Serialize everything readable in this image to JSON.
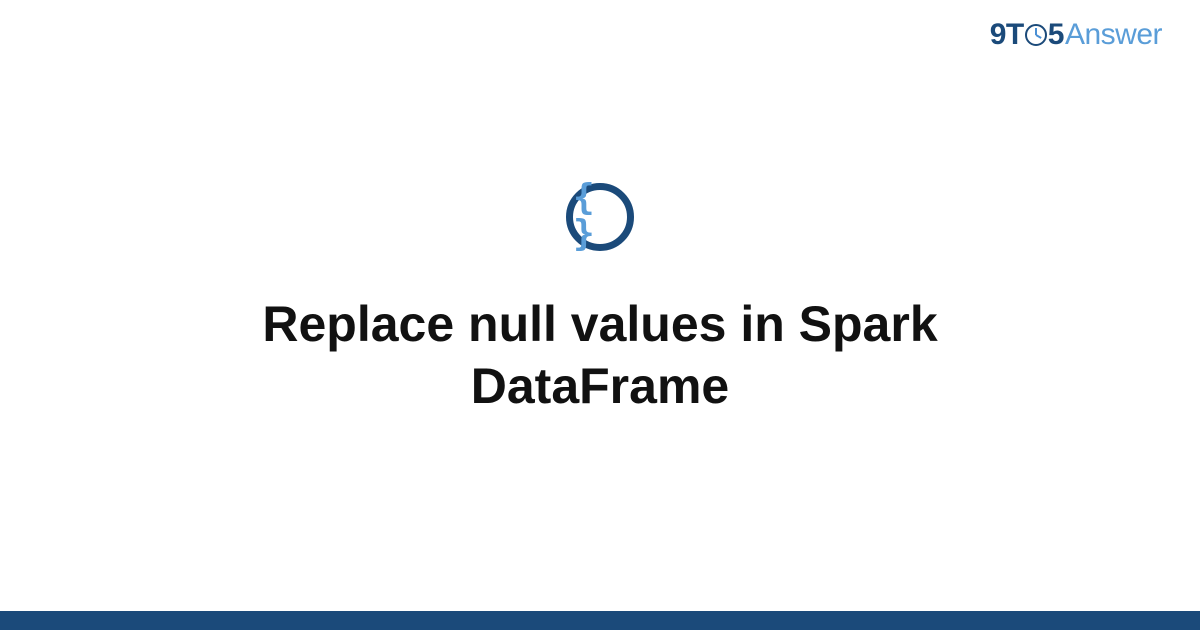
{
  "brand": {
    "part1": "9T",
    "part2": "5",
    "part3": "Answer"
  },
  "icon": {
    "braces": "{ }"
  },
  "main": {
    "title": "Replace null values in Spark DataFrame"
  },
  "colors": {
    "primary_dark": "#1b4a7a",
    "primary_light": "#5a9dd8"
  }
}
